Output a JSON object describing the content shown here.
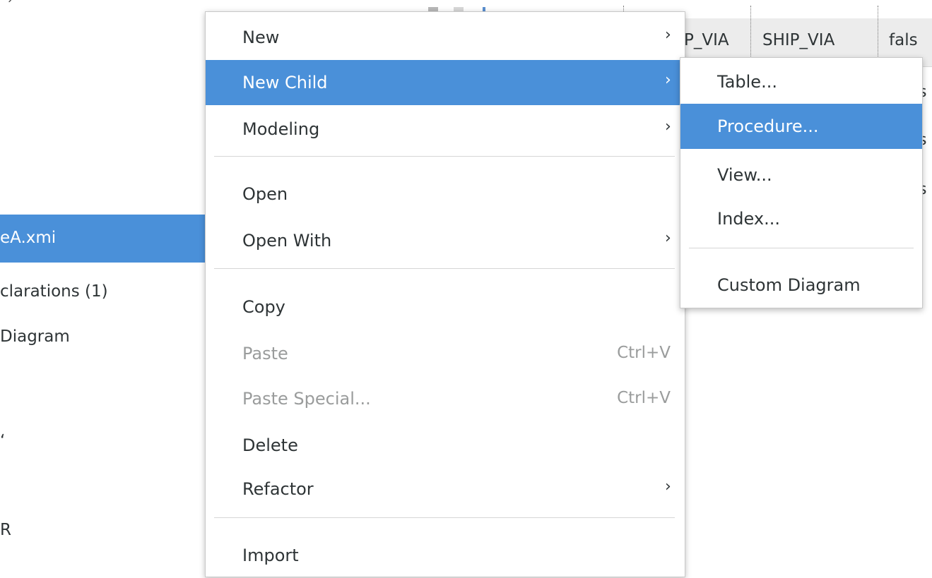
{
  "background": {
    "tree": {
      "selected_item": "eA.xmi",
      "items": [
        "clarations (1)",
        "Diagram",
        "ʻ",
        "R"
      ],
      "top_fragment": "ˊ"
    },
    "table": {
      "columns": [
        "P_VIA",
        "SHIP_VIA",
        "fals"
      ],
      "row_fragments": [
        "s",
        "s",
        "s"
      ]
    }
  },
  "context_menu": {
    "items": [
      {
        "label": "New",
        "has_submenu": true
      },
      {
        "label": "New Child",
        "has_submenu": true,
        "selected": true
      },
      {
        "label": "Modeling",
        "has_submenu": true
      },
      {
        "label": "Open"
      },
      {
        "label": "Open With",
        "has_submenu": true
      },
      {
        "label": "Copy"
      },
      {
        "label": "Paste",
        "accelerator": "Ctrl+V",
        "disabled": true
      },
      {
        "label": "Paste Special...",
        "accelerator": "Ctrl+V",
        "disabled": true
      },
      {
        "label": "Delete"
      },
      {
        "label": "Refactor",
        "has_submenu": true
      },
      {
        "label": "Import"
      }
    ],
    "submenu_arrow": "›"
  },
  "submenu": {
    "items": [
      {
        "label": "Table..."
      },
      {
        "label": "Procedure...",
        "selected": true
      },
      {
        "label": "View..."
      },
      {
        "label": "Index..."
      },
      {
        "label": "Custom Diagram"
      }
    ]
  },
  "colors": {
    "selection": "#4a90d9",
    "text": "#2e3436",
    "disabled_text": "#9a9c9c",
    "menu_background": "#ffffff"
  }
}
